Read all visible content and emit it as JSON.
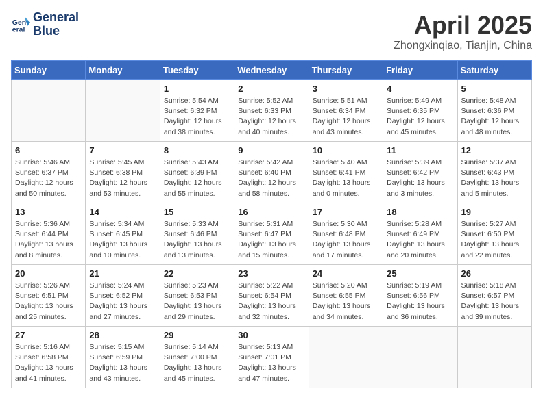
{
  "header": {
    "logo_line1": "General",
    "logo_line2": "Blue",
    "month_title": "April 2025",
    "location": "Zhongxinqiao, Tianjin, China"
  },
  "weekdays": [
    "Sunday",
    "Monday",
    "Tuesday",
    "Wednesday",
    "Thursday",
    "Friday",
    "Saturday"
  ],
  "weeks": [
    [
      {
        "day": "",
        "sunrise": "",
        "sunset": "",
        "daylight": ""
      },
      {
        "day": "",
        "sunrise": "",
        "sunset": "",
        "daylight": ""
      },
      {
        "day": "1",
        "sunrise": "Sunrise: 5:54 AM",
        "sunset": "Sunset: 6:32 PM",
        "daylight": "Daylight: 12 hours and 38 minutes."
      },
      {
        "day": "2",
        "sunrise": "Sunrise: 5:52 AM",
        "sunset": "Sunset: 6:33 PM",
        "daylight": "Daylight: 12 hours and 40 minutes."
      },
      {
        "day": "3",
        "sunrise": "Sunrise: 5:51 AM",
        "sunset": "Sunset: 6:34 PM",
        "daylight": "Daylight: 12 hours and 43 minutes."
      },
      {
        "day": "4",
        "sunrise": "Sunrise: 5:49 AM",
        "sunset": "Sunset: 6:35 PM",
        "daylight": "Daylight: 12 hours and 45 minutes."
      },
      {
        "day": "5",
        "sunrise": "Sunrise: 5:48 AM",
        "sunset": "Sunset: 6:36 PM",
        "daylight": "Daylight: 12 hours and 48 minutes."
      }
    ],
    [
      {
        "day": "6",
        "sunrise": "Sunrise: 5:46 AM",
        "sunset": "Sunset: 6:37 PM",
        "daylight": "Daylight: 12 hours and 50 minutes."
      },
      {
        "day": "7",
        "sunrise": "Sunrise: 5:45 AM",
        "sunset": "Sunset: 6:38 PM",
        "daylight": "Daylight: 12 hours and 53 minutes."
      },
      {
        "day": "8",
        "sunrise": "Sunrise: 5:43 AM",
        "sunset": "Sunset: 6:39 PM",
        "daylight": "Daylight: 12 hours and 55 minutes."
      },
      {
        "day": "9",
        "sunrise": "Sunrise: 5:42 AM",
        "sunset": "Sunset: 6:40 PM",
        "daylight": "Daylight: 12 hours and 58 minutes."
      },
      {
        "day": "10",
        "sunrise": "Sunrise: 5:40 AM",
        "sunset": "Sunset: 6:41 PM",
        "daylight": "Daylight: 13 hours and 0 minutes."
      },
      {
        "day": "11",
        "sunrise": "Sunrise: 5:39 AM",
        "sunset": "Sunset: 6:42 PM",
        "daylight": "Daylight: 13 hours and 3 minutes."
      },
      {
        "day": "12",
        "sunrise": "Sunrise: 5:37 AM",
        "sunset": "Sunset: 6:43 PM",
        "daylight": "Daylight: 13 hours and 5 minutes."
      }
    ],
    [
      {
        "day": "13",
        "sunrise": "Sunrise: 5:36 AM",
        "sunset": "Sunset: 6:44 PM",
        "daylight": "Daylight: 13 hours and 8 minutes."
      },
      {
        "day": "14",
        "sunrise": "Sunrise: 5:34 AM",
        "sunset": "Sunset: 6:45 PM",
        "daylight": "Daylight: 13 hours and 10 minutes."
      },
      {
        "day": "15",
        "sunrise": "Sunrise: 5:33 AM",
        "sunset": "Sunset: 6:46 PM",
        "daylight": "Daylight: 13 hours and 13 minutes."
      },
      {
        "day": "16",
        "sunrise": "Sunrise: 5:31 AM",
        "sunset": "Sunset: 6:47 PM",
        "daylight": "Daylight: 13 hours and 15 minutes."
      },
      {
        "day": "17",
        "sunrise": "Sunrise: 5:30 AM",
        "sunset": "Sunset: 6:48 PM",
        "daylight": "Daylight: 13 hours and 17 minutes."
      },
      {
        "day": "18",
        "sunrise": "Sunrise: 5:28 AM",
        "sunset": "Sunset: 6:49 PM",
        "daylight": "Daylight: 13 hours and 20 minutes."
      },
      {
        "day": "19",
        "sunrise": "Sunrise: 5:27 AM",
        "sunset": "Sunset: 6:50 PM",
        "daylight": "Daylight: 13 hours and 22 minutes."
      }
    ],
    [
      {
        "day": "20",
        "sunrise": "Sunrise: 5:26 AM",
        "sunset": "Sunset: 6:51 PM",
        "daylight": "Daylight: 13 hours and 25 minutes."
      },
      {
        "day": "21",
        "sunrise": "Sunrise: 5:24 AM",
        "sunset": "Sunset: 6:52 PM",
        "daylight": "Daylight: 13 hours and 27 minutes."
      },
      {
        "day": "22",
        "sunrise": "Sunrise: 5:23 AM",
        "sunset": "Sunset: 6:53 PM",
        "daylight": "Daylight: 13 hours and 29 minutes."
      },
      {
        "day": "23",
        "sunrise": "Sunrise: 5:22 AM",
        "sunset": "Sunset: 6:54 PM",
        "daylight": "Daylight: 13 hours and 32 minutes."
      },
      {
        "day": "24",
        "sunrise": "Sunrise: 5:20 AM",
        "sunset": "Sunset: 6:55 PM",
        "daylight": "Daylight: 13 hours and 34 minutes."
      },
      {
        "day": "25",
        "sunrise": "Sunrise: 5:19 AM",
        "sunset": "Sunset: 6:56 PM",
        "daylight": "Daylight: 13 hours and 36 minutes."
      },
      {
        "day": "26",
        "sunrise": "Sunrise: 5:18 AM",
        "sunset": "Sunset: 6:57 PM",
        "daylight": "Daylight: 13 hours and 39 minutes."
      }
    ],
    [
      {
        "day": "27",
        "sunrise": "Sunrise: 5:16 AM",
        "sunset": "Sunset: 6:58 PM",
        "daylight": "Daylight: 13 hours and 41 minutes."
      },
      {
        "day": "28",
        "sunrise": "Sunrise: 5:15 AM",
        "sunset": "Sunset: 6:59 PM",
        "daylight": "Daylight: 13 hours and 43 minutes."
      },
      {
        "day": "29",
        "sunrise": "Sunrise: 5:14 AM",
        "sunset": "Sunset: 7:00 PM",
        "daylight": "Daylight: 13 hours and 45 minutes."
      },
      {
        "day": "30",
        "sunrise": "Sunrise: 5:13 AM",
        "sunset": "Sunset: 7:01 PM",
        "daylight": "Daylight: 13 hours and 47 minutes."
      },
      {
        "day": "",
        "sunrise": "",
        "sunset": "",
        "daylight": ""
      },
      {
        "day": "",
        "sunrise": "",
        "sunset": "",
        "daylight": ""
      },
      {
        "day": "",
        "sunrise": "",
        "sunset": "",
        "daylight": ""
      }
    ]
  ]
}
